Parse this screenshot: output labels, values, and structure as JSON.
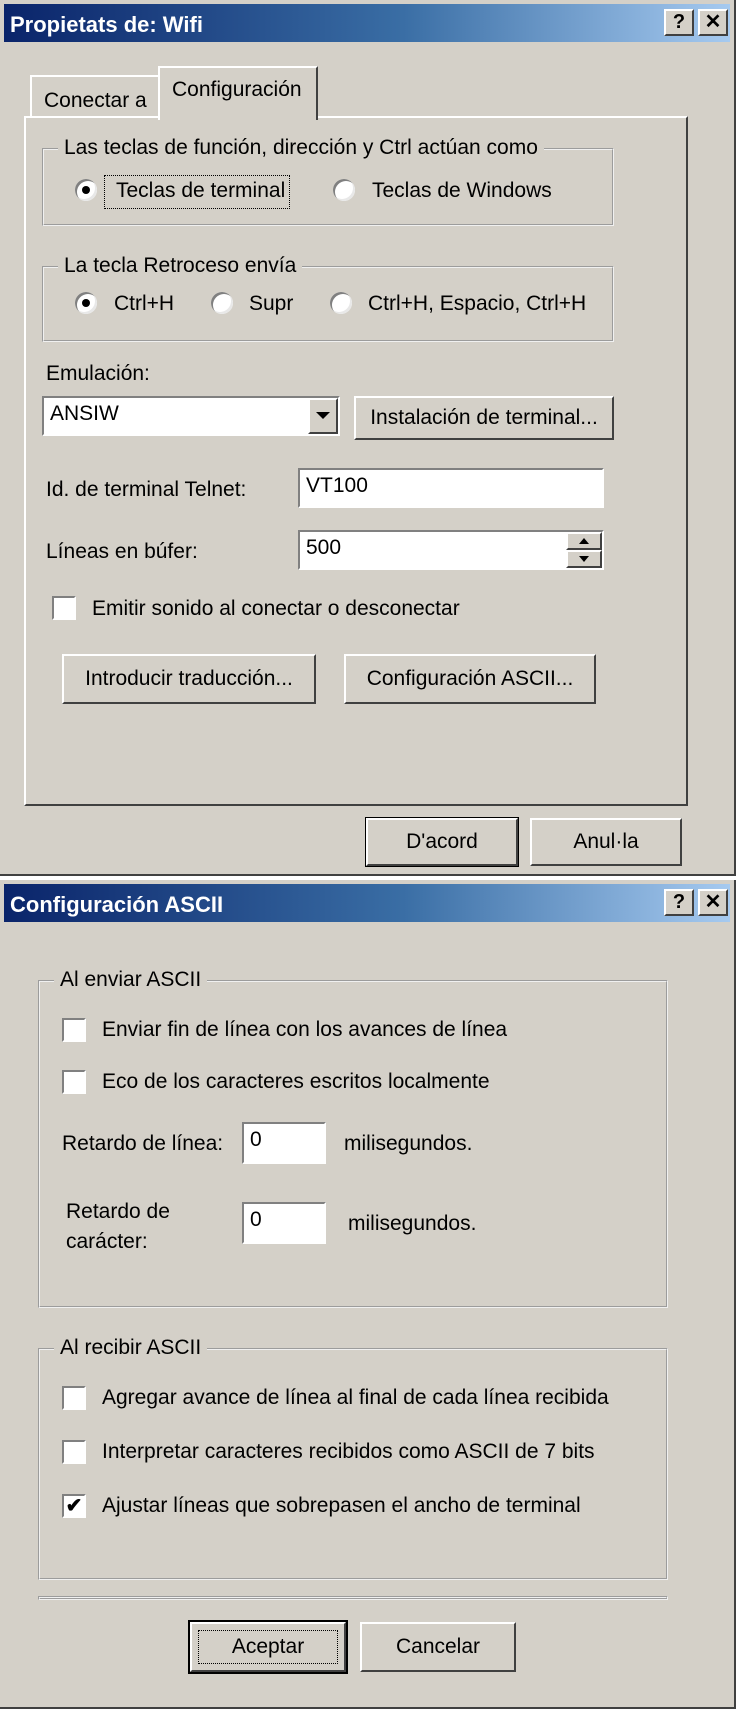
{
  "dialog1": {
    "title": "Propietats de: Wifi",
    "help_glyph": "?",
    "close_glyph": "✕",
    "tabs": [
      {
        "label": "Conectar a"
      },
      {
        "label": "Configuración",
        "selected": true
      }
    ],
    "keys_group": {
      "label": "Las teclas de función, dirección y Ctrl actúan como",
      "options": [
        {
          "label": "Teclas de terminal",
          "selected": true
        },
        {
          "label": "Teclas de Windows",
          "selected": false
        }
      ]
    },
    "backspace_group": {
      "label": "La tecla Retroceso envía",
      "options": [
        {
          "label": "Ctrl+H",
          "selected": true
        },
        {
          "label": "Supr",
          "selected": false
        },
        {
          "label": "Ctrl+H, Espacio, Ctrl+H",
          "selected": false
        }
      ]
    },
    "emulation": {
      "label": "Emulación:",
      "value": "ANSIW",
      "setup_button": "Instalación de terminal..."
    },
    "telnet_id": {
      "label": "Id. de terminal Telnet:",
      "value": "VT100"
    },
    "buffer_lines": {
      "label": "Líneas en búfer:",
      "value": "500"
    },
    "sound_checkbox": {
      "label": "Emitir sonido al conectar o desconectar",
      "checked": false
    },
    "translation_button": "Introducir traducción...",
    "ascii_button": "Configuración ASCII...",
    "ok_button": "D'acord",
    "cancel_button": "Anul·la"
  },
  "dialog2": {
    "title": "Configuración ASCII",
    "help_glyph": "?",
    "close_glyph": "✕",
    "send_group": {
      "label": "Al enviar ASCII",
      "send_line_ends": {
        "label": "Enviar fin de línea con los avances de línea",
        "checked": false
      },
      "echo_local": {
        "label": "Eco de los caracteres escritos localmente",
        "checked": false
      },
      "line_delay": {
        "label": "Retardo de línea:",
        "value": "0",
        "unit": "milisegundos."
      },
      "char_delay": {
        "label_line1": "Retardo de",
        "label_line2": "carácter:",
        "value": "0",
        "unit": "milisegundos."
      }
    },
    "receive_group": {
      "label": "Al recibir ASCII",
      "append_line_feeds": {
        "label": "Agregar avance de línea al final de cada línea recibida",
        "checked": false
      },
      "force_7bit": {
        "label": "Interpretar caracteres recibidos como ASCII de 7 bits",
        "checked": false
      },
      "wrap_lines": {
        "label": "Ajustar líneas que sobrepasen el ancho de terminal",
        "checked": true
      }
    },
    "accept_button": "Aceptar",
    "cancel_button": "Cancelar"
  }
}
